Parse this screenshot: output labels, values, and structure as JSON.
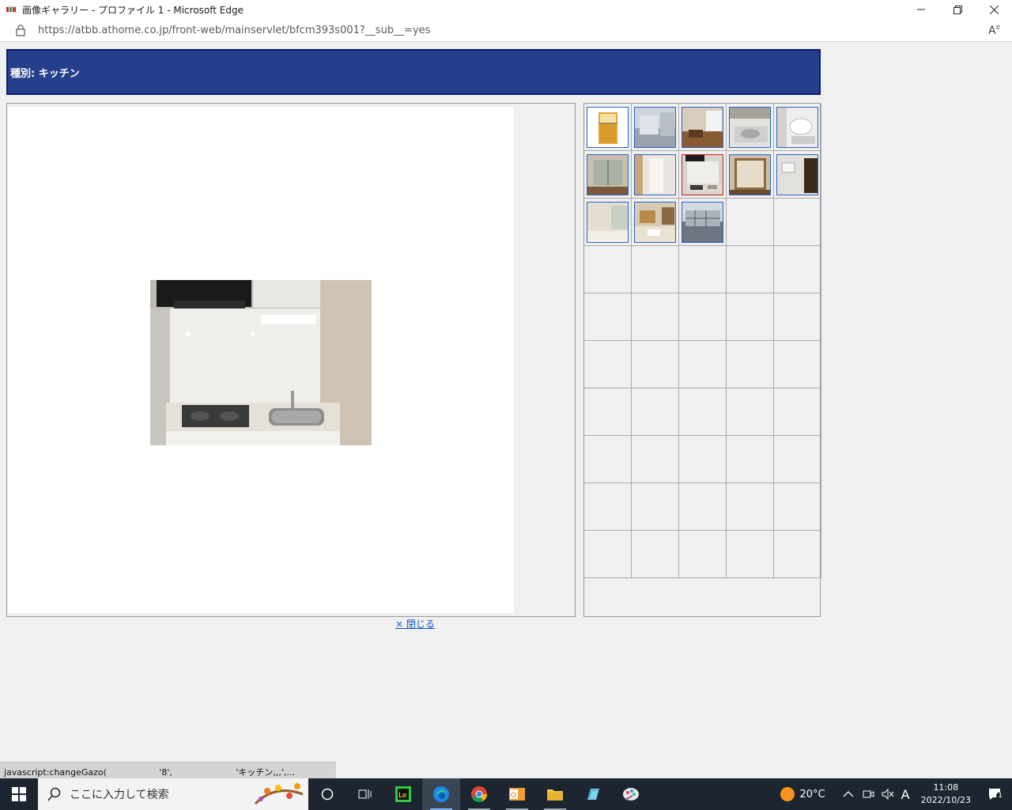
{
  "window": {
    "title": "画像ギャラリー - プロファイル 1 - Microsoft Edge",
    "url": "https://atbb.athome.co.jp/front-web/mainservlet/bfcm393s001?__sub__=yes",
    "read_aloud_label": "A̅"
  },
  "page": {
    "header_title": "種別: キッチン",
    "close_link": "× 閉じる",
    "selected_thumb_index": 7
  },
  "thumbnails": [
    {
      "name": "floorplan-thumb",
      "kind": "floorplan"
    },
    {
      "name": "exterior-thumb",
      "kind": "exterior"
    },
    {
      "name": "living-room-thumb",
      "kind": "room-brown"
    },
    {
      "name": "kitchen-sink-thumb",
      "kind": "sink"
    },
    {
      "name": "bathroom-thumb",
      "kind": "bath"
    },
    {
      "name": "window-room-thumb",
      "kind": "window"
    },
    {
      "name": "hallway-thumb",
      "kind": "hall"
    },
    {
      "name": "kitchen-thumb",
      "kind": "kitchen"
    },
    {
      "name": "closet-thumb",
      "kind": "closet"
    },
    {
      "name": "entrance-thumb",
      "kind": "entrance"
    },
    {
      "name": "bedroom-thumb",
      "kind": "bedroom"
    },
    {
      "name": "furnished-room-thumb",
      "kind": "furnished"
    },
    {
      "name": "building-thumb",
      "kind": "building"
    }
  ],
  "status_bar": "javascript:changeGazo(                   '8',                       'キッチン,,,',...",
  "taskbar": {
    "search_placeholder": "ここに入力して検索",
    "weather": "20°C",
    "time": "11:08",
    "date": "2022/10/23",
    "ime": "A",
    "notification_count": "1"
  },
  "colors": {
    "header_band": "#243f8c",
    "thumb_border": "#2b63c7",
    "selected_border": "#c02020",
    "taskbar": "#1c2530"
  }
}
